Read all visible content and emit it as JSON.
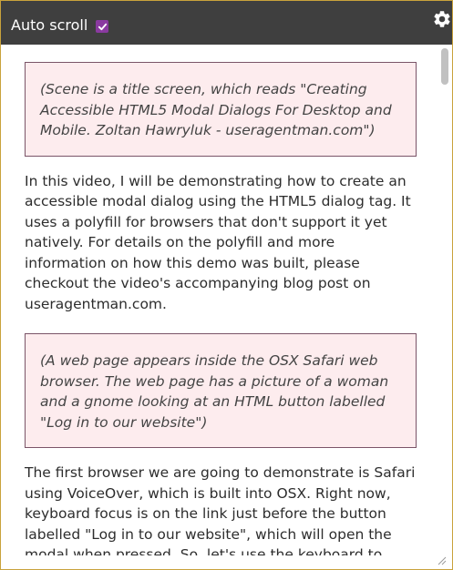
{
  "toolbar": {
    "auto_scroll_label": "Auto scroll",
    "auto_scroll_checked": true,
    "settings_icon": "gear-icon",
    "accent_color": "#8a3aa0",
    "background_color": "#3f3f3f"
  },
  "transcript": {
    "desc_1": "(Scene is a title screen, which reads \"Creating Accessible HTML5 Modal Dialogs For Desktop and Mobile. Zoltan Hawryluk - useragentman.com\")",
    "para_1": "In this video, I will be demonstrating how to create an accessible modal dialog using the HTML5 dialog tag. It uses a polyfill for browsers that don't support it yet natively. For details on the polyfill and more information on how this demo was built, please checkout the video's accompanying blog post on useragentman.com.",
    "desc_2": "(A web page appears inside the OSX Safari web browser. The web page has a picture of a woman and a gnome looking at an HTML button labelled \"Log in to our website\")",
    "para_2": "The first browser we are going to demonstrate is Safari using VoiceOver, which is built into OSX. Right now, keyboard focus is on the link just before the button labelled \"Log in to our website\", which will open the modal when pressed. So, let's use the keyboard to",
    "description_background": "#fdecee",
    "description_border": "#7a5468"
  },
  "panel": {
    "border_color": "#c9a23c"
  }
}
